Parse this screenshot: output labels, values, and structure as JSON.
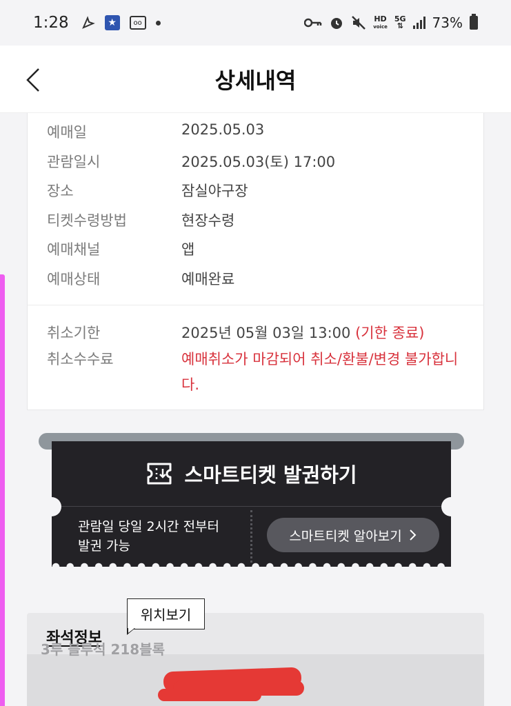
{
  "status_bar": {
    "time": "1:28",
    "network_hd": "HD",
    "network_voice": "voice",
    "network_5g": "5G",
    "battery": "73%"
  },
  "header": {
    "title": "상세내역"
  },
  "details": {
    "booking_date_label": "예매일",
    "booking_date": "2025.05.03",
    "view_datetime_label": "관람일시",
    "view_datetime": "2025.05.03(토) 17:00",
    "place_label": "장소",
    "place": "잠실야구장",
    "receive_method_label": "티켓수령방법",
    "receive_method": "현장수령",
    "channel_label": "예매채널",
    "channel": "앱",
    "status_label": "예매상태",
    "status": "예매완료"
  },
  "cancel": {
    "deadline_label": "취소기한",
    "deadline": "2025년 05월 03일 13:00",
    "deadline_note": "(기한 종료)",
    "fee_label": "취소수수료",
    "fee_text": "예매취소가 마감되어 취소/환불/변경 불가합니다."
  },
  "smart_ticket": {
    "title": "스마트티켓 발권하기",
    "desc_line1": "관람일 당일 2시간 전부터",
    "desc_line2": "발권 가능",
    "learn_button": "스마트티켓 알아보기"
  },
  "seat": {
    "title": "좌석정보",
    "tooltip": "위치보기",
    "seat_text": "3루 블루석 218블록"
  },
  "colors": {
    "accent_red": "#d8323c",
    "ticket_dark": "#232226",
    "edge_pink": "#ee5df0"
  }
}
